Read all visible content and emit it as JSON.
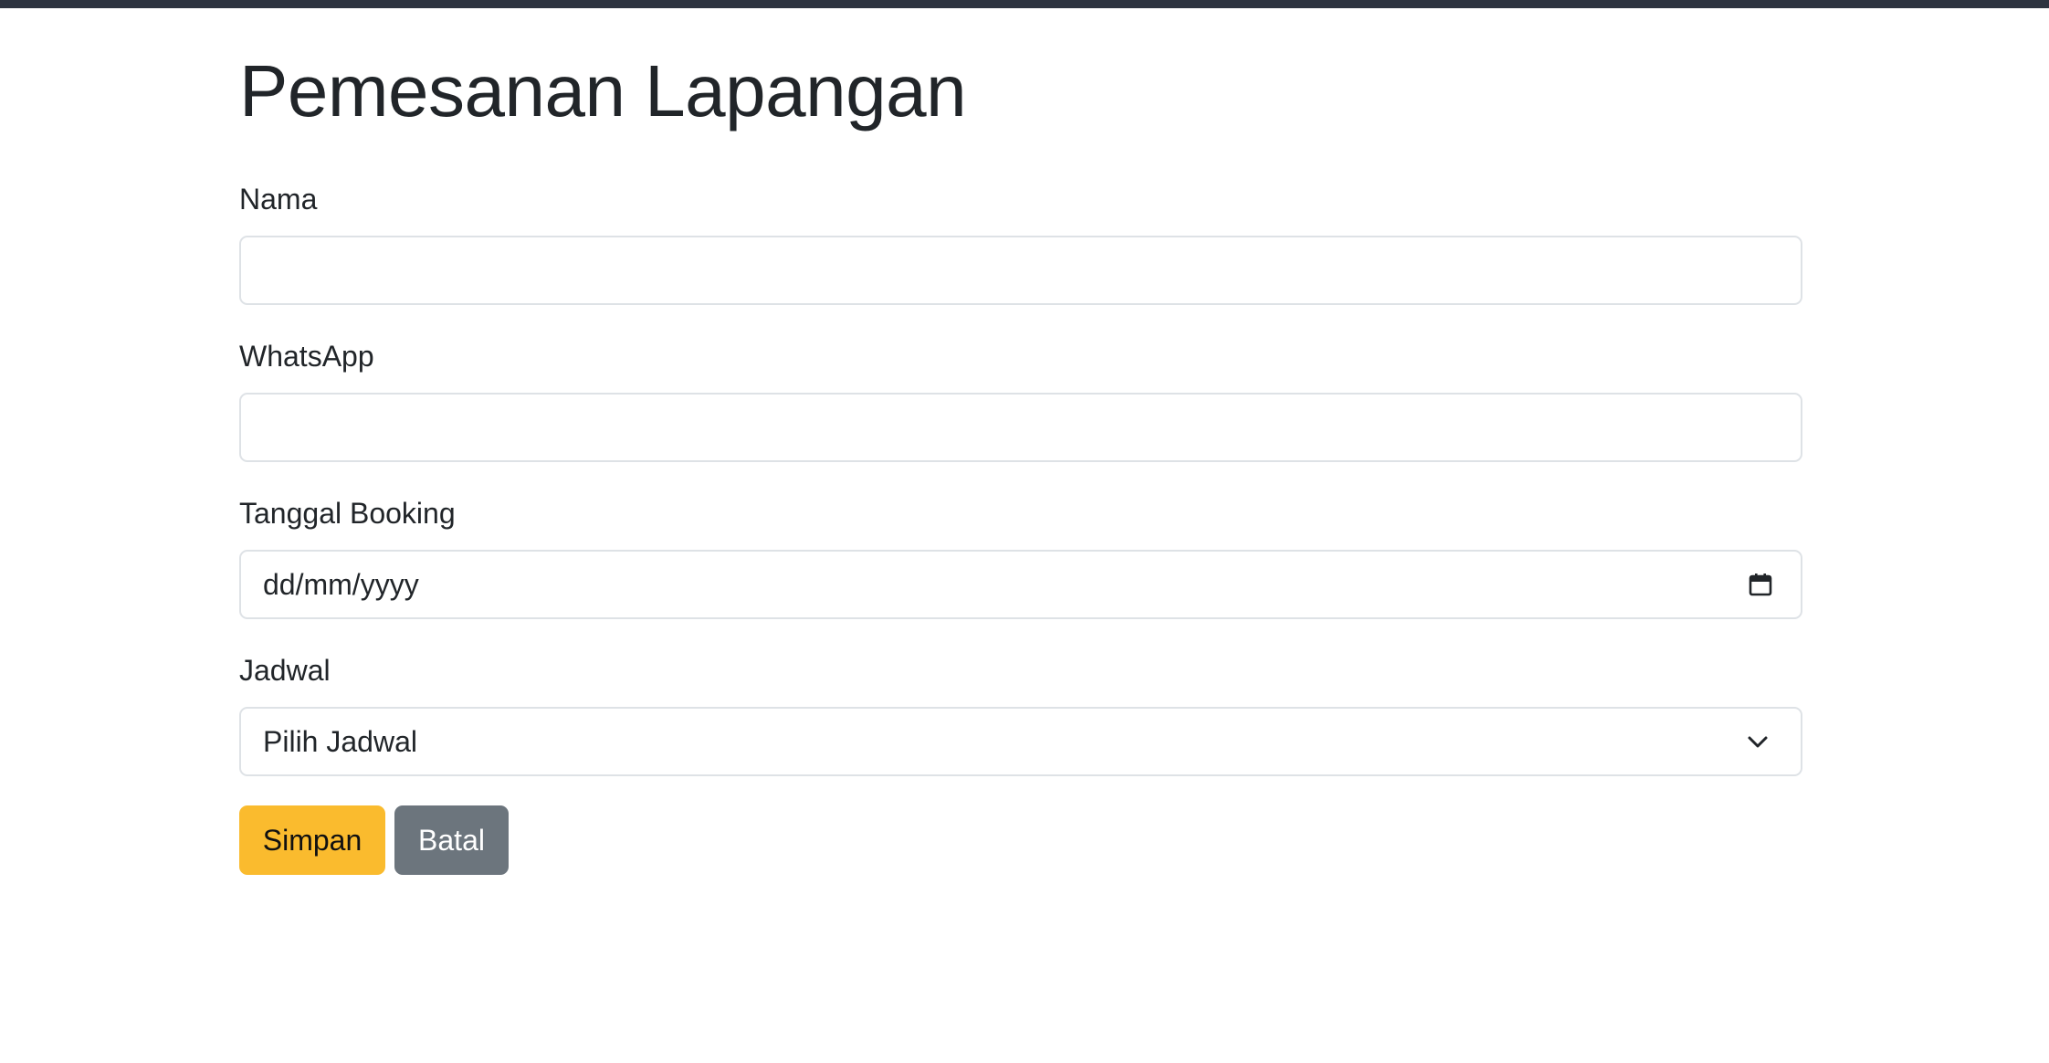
{
  "page": {
    "title": "Pemesanan Lapangan"
  },
  "form": {
    "name": {
      "label": "Nama",
      "value": "",
      "placeholder": ""
    },
    "whatsapp": {
      "label": "WhatsApp",
      "value": "",
      "placeholder": ""
    },
    "booking_date": {
      "label": "Tanggal Booking",
      "placeholder": "dd/mm/yyyy",
      "icon": "calendar-icon"
    },
    "schedule": {
      "label": "Jadwal",
      "selected": "Pilih Jadwal",
      "icon": "chevron-down-icon"
    }
  },
  "actions": {
    "save_label": "Simpan",
    "cancel_label": "Batal"
  },
  "colors": {
    "topbar": "#2d3440",
    "save_button": "#fabb2e",
    "cancel_button": "#6c757d",
    "text": "#212529",
    "input_border": "#dee2e6"
  }
}
